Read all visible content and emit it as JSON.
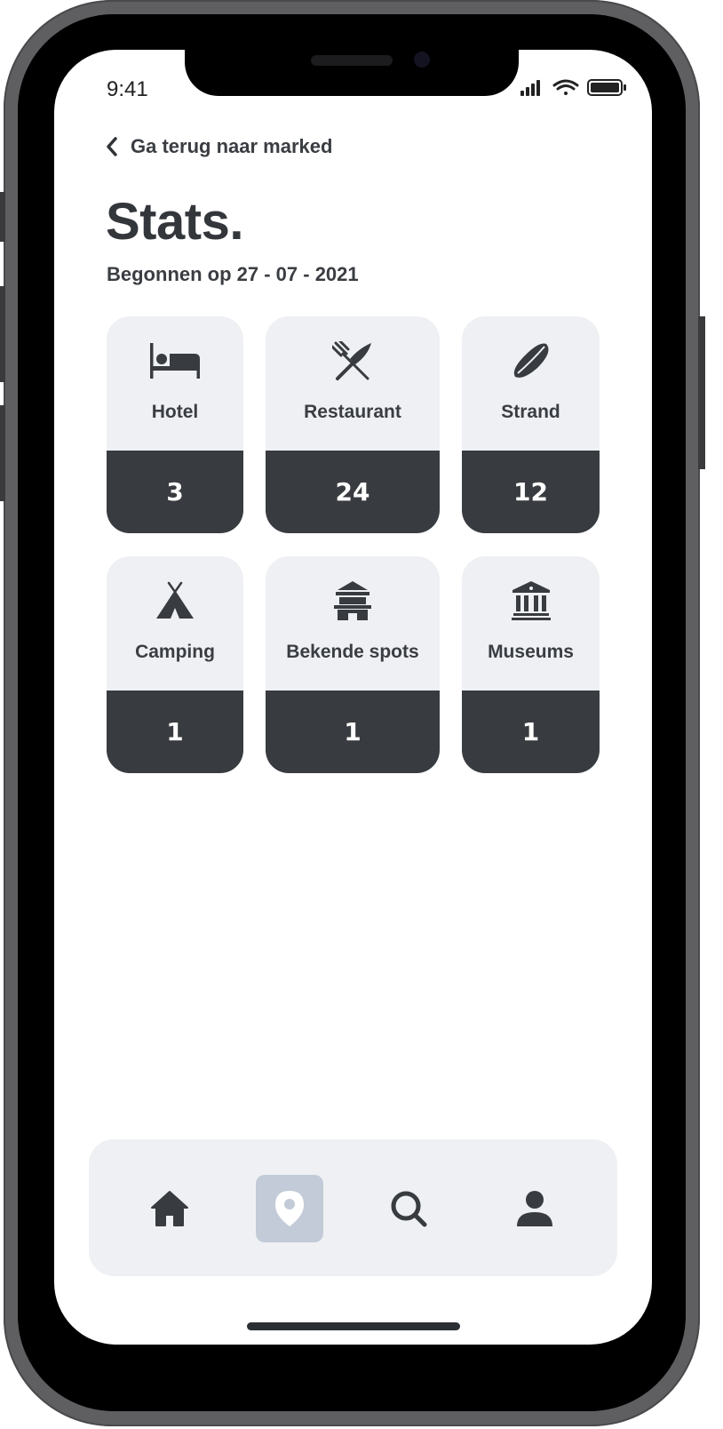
{
  "status_bar": {
    "time": "9:41"
  },
  "nav": {
    "back_label": "Ga terug naar marked"
  },
  "page": {
    "title": "Stats.",
    "subtitle": "Begonnen op 27 - 07 - 2021"
  },
  "categories": [
    {
      "label": "Hotel",
      "count": "3",
      "icon": "bed-icon"
    },
    {
      "label": "Restaurant",
      "count": "24",
      "icon": "utensils-icon"
    },
    {
      "label": "Strand",
      "count": "12",
      "icon": "surfboard-icon"
    },
    {
      "label": "Camping",
      "count": "1",
      "icon": "tent-icon"
    },
    {
      "label": "Bekende spots",
      "count": "1",
      "icon": "landmark-building-icon"
    },
    {
      "label": "Museums",
      "count": "1",
      "icon": "museum-icon"
    }
  ],
  "tabbar": {
    "items": [
      {
        "icon": "home-icon",
        "active": false
      },
      {
        "icon": "map-pin-icon",
        "active": true
      },
      {
        "icon": "search-icon",
        "active": false
      },
      {
        "icon": "user-icon",
        "active": false
      }
    ]
  },
  "colors": {
    "dark": "#383b3f",
    "card_bg": "#eef0f3",
    "active_tab": "#c2cbd7",
    "text": "#3a3d42"
  }
}
